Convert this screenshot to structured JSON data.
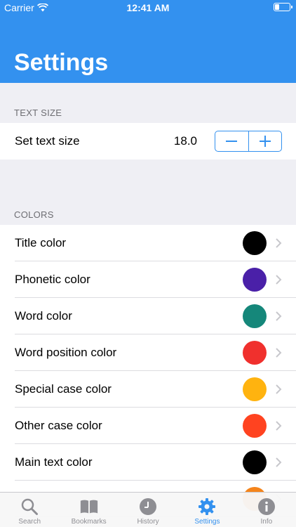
{
  "status": {
    "carrier": "Carrier",
    "time": "12:41 AM"
  },
  "page": {
    "title": "Settings"
  },
  "text_size": {
    "section": "TEXT SIZE",
    "label": "Set text size",
    "value": "18.0"
  },
  "colors": {
    "section": "COLORS",
    "items": [
      {
        "label": "Title color",
        "color": "#000000"
      },
      {
        "label": "Phonetic color",
        "color": "#4a20a8"
      },
      {
        "label": "Word color",
        "color": "#15877a"
      },
      {
        "label": "Word position color",
        "color": "#f0302d"
      },
      {
        "label": "Special case color",
        "color": "#ffb30f"
      },
      {
        "label": "Other case color",
        "color": "#ff4320"
      },
      {
        "label": "Main text color",
        "color": "#000000"
      },
      {
        "label": "",
        "color": "#f5841a"
      }
    ]
  },
  "tabs": [
    {
      "label": "Search",
      "icon": "search-icon"
    },
    {
      "label": "Bookmarks",
      "icon": "book-icon"
    },
    {
      "label": "History",
      "icon": "clock-icon"
    },
    {
      "label": "Settings",
      "icon": "gear-icon",
      "active": true
    },
    {
      "label": "Info",
      "icon": "info-icon"
    }
  ],
  "theme": {
    "accent": "#3391ef",
    "inactive": "#8e8e93"
  }
}
